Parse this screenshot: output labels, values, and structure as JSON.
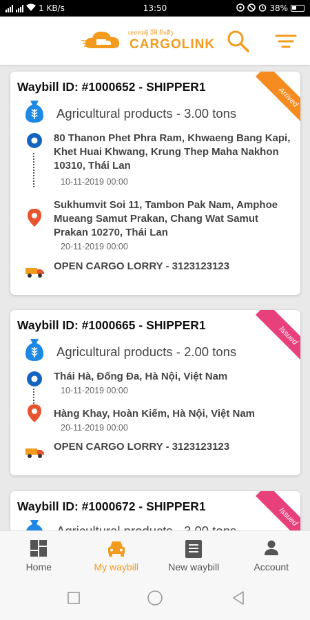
{
  "status_bar": {
    "speed": "1 KB/s",
    "time": "13:50",
    "battery": "38%"
  },
  "app": {
    "brand_name": "CARGOLINK",
    "tagline": "ເຂດກະທູ້ ວິທີ ຂົນສົ່ງ",
    "accent": "#f39b1e"
  },
  "header": {
    "search_icon": "search-icon",
    "filter_icon": "filter-icon"
  },
  "waybills": [
    {
      "title": "Waybill ID: #1000652 - SHIPPER1",
      "status": "Arrived",
      "status_color": "#f68b1f",
      "product": "Agricultural products - 3.00 tons",
      "from_address": "80 Thanon Phet Phra Ram, Khwaeng Bang Kapi, Khet Huai Khwang, Krung Thep Maha Nakhon 10310, Thái Lan",
      "from_date": "10-11-2019 00:00",
      "to_address": "Sukhumvit Soi 11, Tambon Pak Nam, Amphoe Mueang Samut Prakan, Chang Wat Samut Prakan 10270, Thái Lan",
      "to_date": "20-11-2019 00:00",
      "vehicle": "OPEN CARGO LORRY - 3123123123"
    },
    {
      "title": "Waybill ID: #1000665 - SHIPPER1",
      "status": "Issued",
      "status_color": "#e8407a",
      "product": "Agricultural products - 2.00 tons",
      "from_address": "Thái Hà, Đống Đa, Hà Nội, Việt Nam",
      "from_date": "10-11-2019 00:00",
      "to_address": "Hàng Khay, Hoàn Kiếm, Hà Nội, Việt Nam",
      "to_date": "20-11-2019 00:00",
      "vehicle": "OPEN CARGO LORRY - 3123123123"
    },
    {
      "title": "Waybill ID: #1000672 - SHIPPER1",
      "status": "Issued",
      "status_color": "#e8407a",
      "product": "Agricultural products - 3.00 tons"
    }
  ],
  "bottom_nav": [
    {
      "label": "Home",
      "icon": "dashboard-icon",
      "active": false
    },
    {
      "label": "My waybill",
      "icon": "car-icon",
      "active": true
    },
    {
      "label": "New waybill",
      "icon": "document-icon",
      "active": false
    },
    {
      "label": "Account",
      "icon": "person-icon",
      "active": false
    }
  ]
}
